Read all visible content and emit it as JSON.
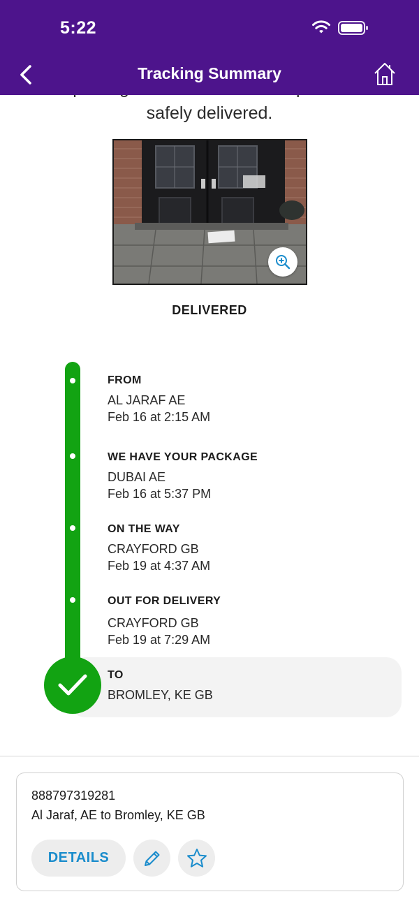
{
  "status_bar": {
    "time": "5:22"
  },
  "header": {
    "title": "Tracking Summary",
    "back_icon": "chevron-left-icon",
    "home_icon": "home-icon"
  },
  "intro": {
    "line1": "Your package was released as requested and",
    "line2": "safely delivered."
  },
  "photo": {
    "alt": "Proof of delivery photo showing package at front door",
    "zoom_icon": "zoom-in-icon"
  },
  "status": "DELIVERED",
  "timeline": [
    {
      "title": "FROM",
      "location": "AL JARAF AE",
      "time": "Feb 16 at 2:15 AM"
    },
    {
      "title": "WE HAVE YOUR PACKAGE",
      "location": "DUBAI AE",
      "time": "Feb 16 at 5:37 PM"
    },
    {
      "title": "ON THE WAY",
      "location": "CRAYFORD GB",
      "time": "Feb 19 at 4:37 AM"
    },
    {
      "title": "OUT FOR DELIVERY",
      "location": "CRAYFORD GB",
      "time": "Feb 19 at 7:29 AM"
    },
    {
      "title": "TO",
      "location": "BROMLEY, KE  GB"
    }
  ],
  "card": {
    "tracking_number": "888797319281",
    "route": "Al Jaraf, AE to Bromley, KE GB",
    "details_label": "DETAILS",
    "edit_icon": "pencil-icon",
    "favorite_icon": "star-icon"
  },
  "colors": {
    "header": "#4d148c",
    "timeline": "#12a312",
    "accent": "#1a8ccc"
  }
}
